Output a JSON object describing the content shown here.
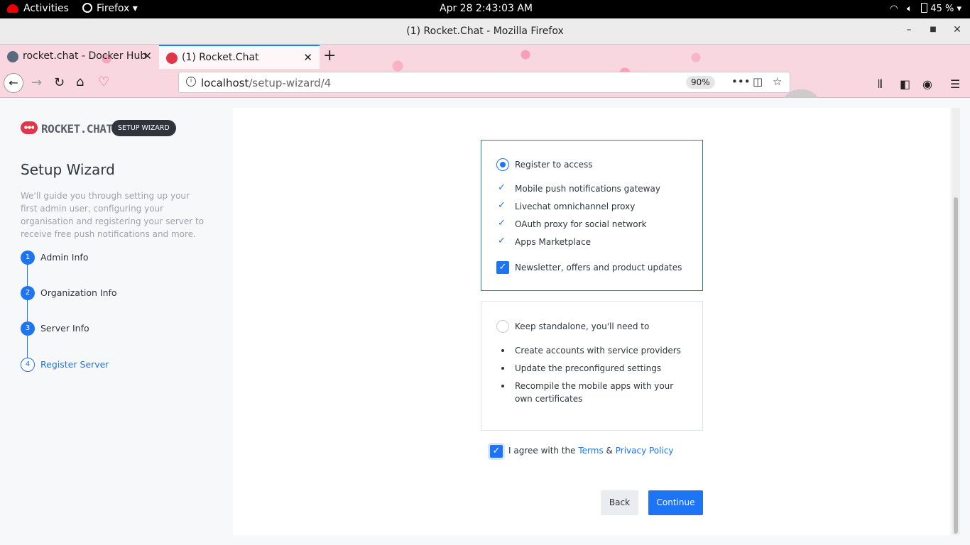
{
  "topbar": {
    "activities": "Activities",
    "app": "Firefox ▾",
    "clock": "Apr 28  2:43:03 AM",
    "battery": "45 %"
  },
  "window": {
    "title": "(1) Rocket.Chat - Mozilla Firefox"
  },
  "tabs": [
    {
      "label": "rocket.chat - Docker Hub",
      "active": false
    },
    {
      "label": "(1) Rocket.Chat",
      "active": true
    }
  ],
  "urlbar": {
    "host": "localhost",
    "path": "/setup-wizard/4",
    "zoom": "90%"
  },
  "sidebar": {
    "logo_text": "ROCKET.CHAT",
    "badge": "SETUP WIZARD",
    "title": "Setup Wizard",
    "description": "We'll guide you through setting up your first admin user, configuring your organisation and registering your server to receive free push notifications and more.",
    "steps": [
      {
        "number": "1",
        "label": "Admin Info"
      },
      {
        "number": "2",
        "label": "Organization Info"
      },
      {
        "number": "3",
        "label": "Server Info"
      },
      {
        "number": "4",
        "label": "Register Server",
        "current": true
      }
    ]
  },
  "register_option": {
    "label": "Register to access",
    "selected": true,
    "features": [
      "Mobile push notifications gateway",
      "Livechat omnichannel proxy",
      "OAuth proxy for social network",
      "Apps Marketplace"
    ],
    "newsletter_label": "Newsletter, offers and product updates",
    "newsletter_checked": true
  },
  "standalone_option": {
    "label": "Keep standalone, you'll need to",
    "selected": false,
    "items": [
      "Create accounts with service providers",
      "Update the preconfigured settings",
      "Recompile the mobile apps with your own certificates"
    ]
  },
  "agree": {
    "prefix": "I agree with the",
    "terms": "Terms",
    "amp": "&",
    "privacy": "Privacy Policy",
    "checked": true
  },
  "buttons": {
    "back": "Back",
    "continue": "Continue"
  },
  "colors": {
    "accent": "#1d74f5",
    "dark": "#2f343d",
    "muted": "#9ea2a8"
  }
}
